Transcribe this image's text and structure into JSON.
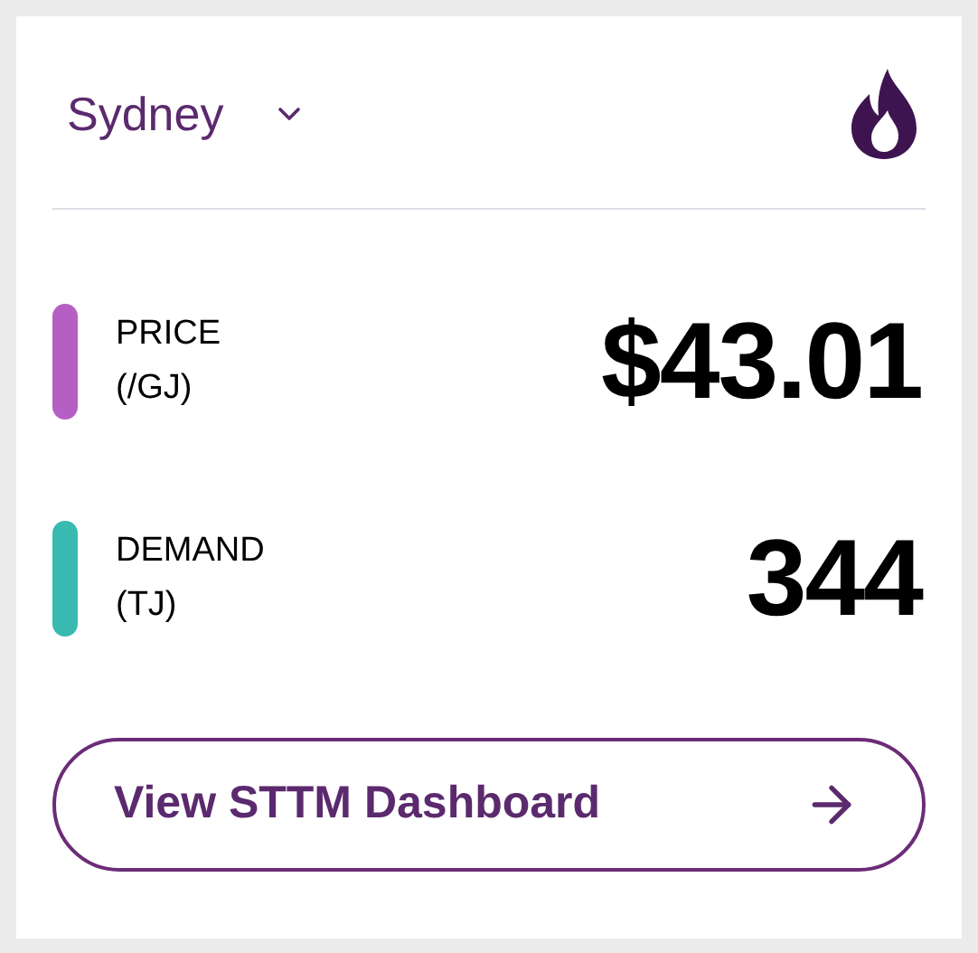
{
  "region_select": {
    "value": "Sydney"
  },
  "metrics": [
    {
      "label": "PRICE",
      "unit": "(/GJ)",
      "value": "$43.01",
      "color": "#b55fc4"
    },
    {
      "label": "DEMAND",
      "unit": "(TJ)",
      "value": "344",
      "color": "#38bab0"
    }
  ],
  "dashboard_button": {
    "label": "View STTM Dashboard"
  }
}
